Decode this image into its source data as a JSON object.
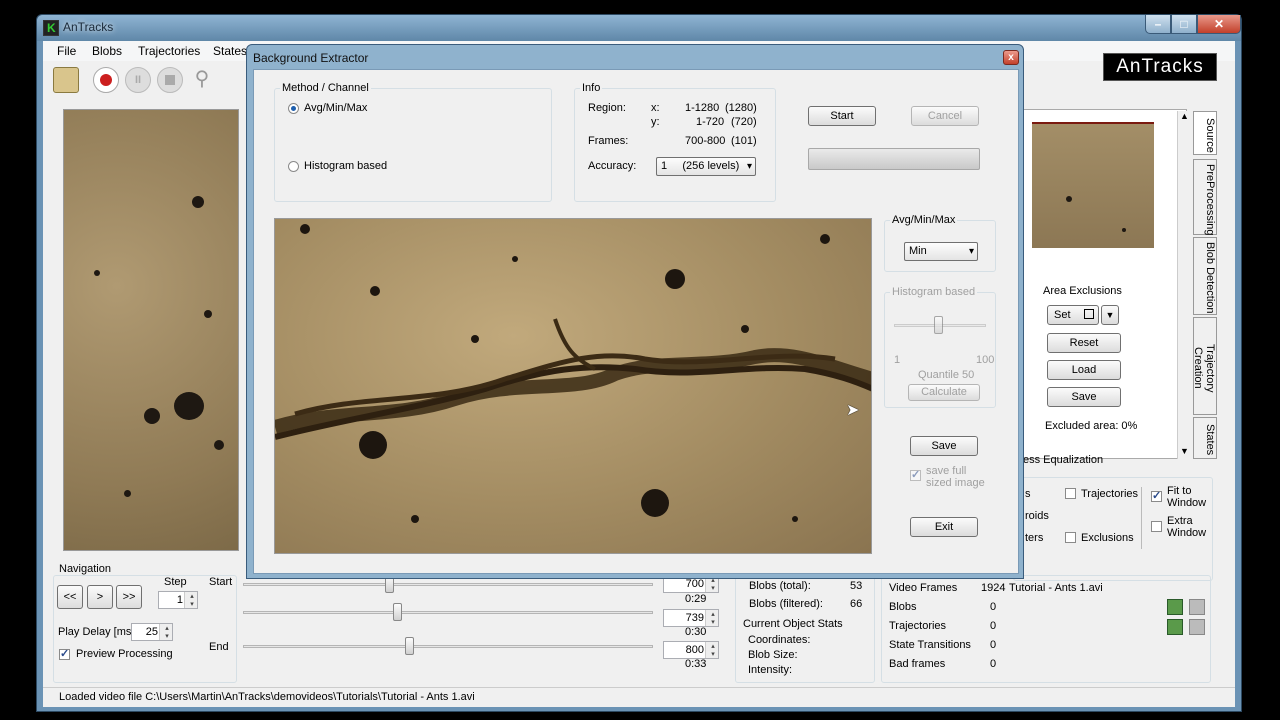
{
  "app": {
    "title": "AnTracks",
    "logo_text": "AnTracks",
    "menu": [
      "File",
      "Blobs",
      "Trajectories",
      "States"
    ]
  },
  "toolbar": {
    "icons": [
      "open-icon",
      "record-icon",
      "pause-icon",
      "stop-icon",
      "zoom-icon"
    ],
    "pause_glyph": "II"
  },
  "window_controls": {
    "minimize": "–",
    "maximize": "□",
    "close": "✕"
  },
  "side_tabs": [
    "Source",
    "PreProcessing",
    "Blob Detection",
    "Trajectory Creation",
    "States"
  ],
  "area_exclusions": {
    "title": "Area Exclusions",
    "set_label": "Set",
    "reset_label": "Reset",
    "load_label": "Load",
    "save_label": "Save",
    "excluded_area": "Excluded area: 0%",
    "cut_text": "ess Equalization"
  },
  "view_options": {
    "cut_labels": [
      "s",
      "roids",
      "ters"
    ],
    "trajectories": "Trajectories",
    "exclusions": "Exclusions",
    "fit_to_window": "Fit to Window",
    "extra_window": "Extra Window",
    "fit_checked": true
  },
  "navigation": {
    "title": "Navigation",
    "prev_label": "<<",
    "play_label": ">",
    "next_label": ">>",
    "step_label": "Step",
    "step_value": "1",
    "play_delay_label": "Play Delay [ms]",
    "play_delay_value": "25",
    "preview_processing": "Preview Processing",
    "start_label": "Start",
    "end_label": "End",
    "start_frame": "700",
    "start_time": "0:29",
    "current_frame": "739",
    "current_time": "0:30",
    "end_frame": "800",
    "end_time": "0:33"
  },
  "stats": {
    "blobs_total_label": "Blobs (total):",
    "blobs_total": "53",
    "blobs_filtered_label": "Blobs (filtered):",
    "blobs_filtered": "66",
    "current_title": "Current Object Stats",
    "coordinates": "Coordinates:",
    "blob_size": "Blob Size:",
    "intensity": "Intensity:"
  },
  "video_stats": {
    "video_frames_label": "Video Frames",
    "video_frames": "1924",
    "file_name": "Tutorial - Ants 1.avi",
    "rows": [
      {
        "label": "Blobs",
        "value": "0"
      },
      {
        "label": "Trajectories",
        "value": "0"
      },
      {
        "label": "State Transitions",
        "value": "0"
      },
      {
        "label": "Bad frames",
        "value": "0"
      }
    ]
  },
  "status_bar": "Loaded video file C:\\Users\\Martin\\AnTracks\\demovideos\\Tutorials\\Tutorial - Ants 1.avi",
  "dialog": {
    "title": "Background Extractor",
    "close_label": "x",
    "method_title": "Method / Channel",
    "method_avg": "Avg/Min/Max",
    "method_hist": "Histogram based",
    "info_title": "Info",
    "region_label": "Region:",
    "x_label": "x:",
    "x_value": "1-1280",
    "x_count": "(1280)",
    "y_label": "y:",
    "y_value": "1-720",
    "y_count": "(720)",
    "frames_label": "Frames:",
    "frames_value": "700-800",
    "frames_count": "(101)",
    "accuracy_label": "Accuracy:",
    "accuracy_value": "1     (256 levels)",
    "start_label": "Start",
    "cancel_label": "Cancel",
    "avgminmax_title": "Avg/Min/Max",
    "avgminmax_value": "Min",
    "hist_title": "Histogram based",
    "hist_min": "1",
    "hist_max": "100",
    "quantile": "Quantile 50",
    "calculate": "Calculate",
    "save": "Save",
    "save_full": "save full sized image",
    "exit": "Exit"
  }
}
